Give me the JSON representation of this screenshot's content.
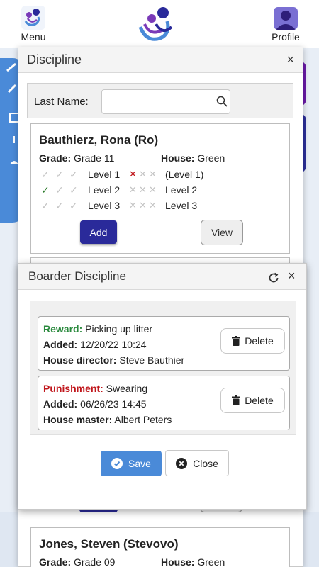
{
  "topbar": {
    "menu_label": "Menu",
    "profile_label": "Profile"
  },
  "discipline": {
    "title": "Discipline",
    "close_glyph": "×",
    "search": {
      "label": "Last Name:",
      "value": "",
      "placeholder": ""
    },
    "students": [
      {
        "name": "Bauthierz, Rona (Ro)",
        "grade_label": "Grade:",
        "grade": "Grade 11",
        "house_label": "House:",
        "house": "Green",
        "levels": [
          {
            "checks": [
              0,
              0,
              0
            ],
            "label": "Level 1",
            "crosses": [
              1,
              0,
              0
            ],
            "label2": "(Level 1)"
          },
          {
            "checks": [
              1,
              0,
              0
            ],
            "label": "Level 2",
            "crosses": [
              0,
              0,
              0
            ],
            "label2": "Level 2"
          },
          {
            "checks": [
              0,
              0,
              0
            ],
            "label": "Level 3",
            "crosses": [
              0,
              0,
              0
            ],
            "label2": "Level 3"
          }
        ],
        "add_label": "Add",
        "view_label": "View"
      },
      {
        "name": "Jones, Steven (Stevovo)",
        "grade_label": "Grade:",
        "grade": "Grade 09",
        "house_label": "House:",
        "house": "Green"
      }
    ]
  },
  "boarder_modal": {
    "title": "Boarder Discipline",
    "close_glyph": "×",
    "entries": [
      {
        "kind": "Reward:",
        "kind_type": "reward",
        "text": "Picking up litter",
        "added_label": "Added:",
        "added": "12/20/22 10:24",
        "by_label": "House director:",
        "by": "Steve Bauthier",
        "delete_label": "Delete"
      },
      {
        "kind": "Punishment:",
        "kind_type": "punishment",
        "text": "Swearing",
        "added_label": "Added:",
        "added": "06/26/23 14:45",
        "by_label": "House master:",
        "by": "Albert Peters",
        "delete_label": "Delete"
      }
    ],
    "save_label": "Save",
    "close_label": "Close"
  },
  "colors": {
    "accent": "#4a8ad8",
    "primary": "#2a2a9a",
    "reward": "#2b8a3e",
    "punishment": "#c0161b"
  }
}
